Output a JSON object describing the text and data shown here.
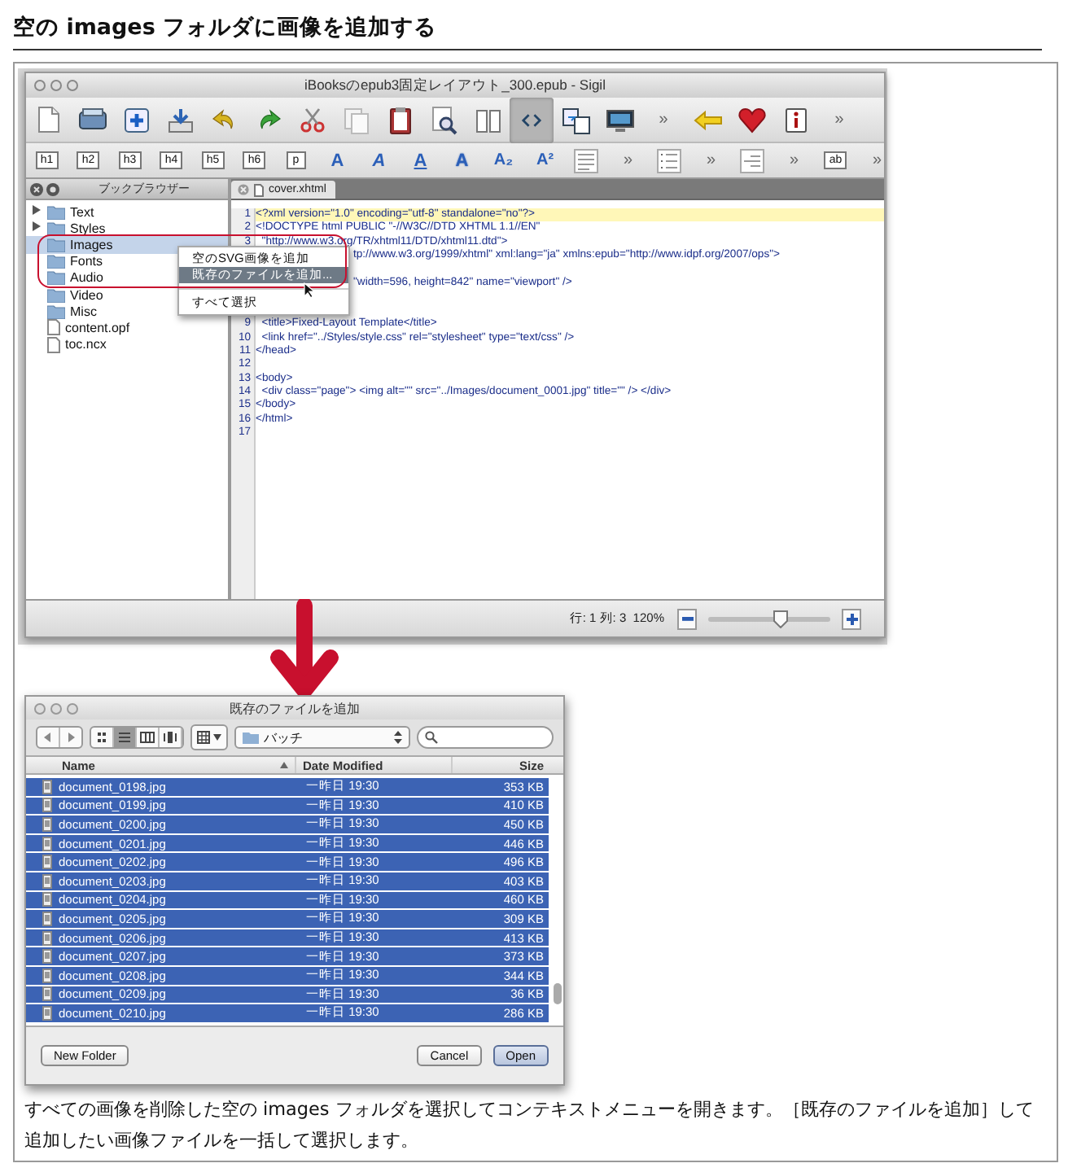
{
  "heading": "空の images フォルダに画像を追加する",
  "sigil": {
    "title": "iBooksのepub3固定レイアウト_300.epub - Sigil",
    "toolbar": [
      {
        "kind": "page"
      },
      {
        "kind": "drawer"
      },
      {
        "kind": "plus"
      },
      {
        "kind": "tray"
      },
      {
        "kind": "undo"
      },
      {
        "kind": "redo"
      },
      {
        "kind": "scissors"
      },
      {
        "kind": "copy"
      },
      {
        "kind": "clipboard"
      },
      {
        "kind": "preview"
      },
      {
        "kind": "book"
      },
      {
        "kind": "code",
        "selected": true
      },
      {
        "kind": "split"
      },
      {
        "kind": "monitor"
      },
      {
        "kind": "text",
        "label": "»"
      },
      {
        "kind": "back"
      },
      {
        "kind": "heart"
      },
      {
        "kind": "info"
      },
      {
        "kind": "text",
        "label": "»"
      }
    ],
    "format_bar": [
      {
        "kind": "tag",
        "label": "h1"
      },
      {
        "kind": "tag",
        "label": "h2"
      },
      {
        "kind": "tag",
        "label": "h3"
      },
      {
        "kind": "tag",
        "label": "h4"
      },
      {
        "kind": "tag",
        "label": "h5"
      },
      {
        "kind": "tag",
        "label": "h6"
      },
      {
        "kind": "tag",
        "label": "p"
      },
      {
        "kind": "bold",
        "label": "A"
      },
      {
        "kind": "italic",
        "label": "A"
      },
      {
        "kind": "underline",
        "label": "A"
      },
      {
        "kind": "outline",
        "label": "A"
      },
      {
        "kind": "subscript",
        "label": "A₂"
      },
      {
        "kind": "superscript",
        "label": "A²"
      },
      {
        "kind": "align"
      },
      {
        "kind": "text",
        "label": "»"
      },
      {
        "kind": "list"
      },
      {
        "kind": "text",
        "label": "»"
      },
      {
        "kind": "indent"
      },
      {
        "kind": "text",
        "label": "»"
      },
      {
        "kind": "tag",
        "label": "ab"
      },
      {
        "kind": "text",
        "label": "»"
      }
    ],
    "browser_title": "ブックブラウザー",
    "tree": [
      {
        "label": "Text",
        "kind": "folder",
        "expandable": true,
        "selected": false
      },
      {
        "label": "Styles",
        "kind": "folder",
        "expandable": true,
        "selected": false
      },
      {
        "label": "Images",
        "kind": "folder",
        "expandable": false,
        "selected": true
      },
      {
        "label": "Fonts",
        "kind": "folder",
        "expandable": false,
        "selected": false
      },
      {
        "label": "Audio",
        "kind": "folder",
        "expandable": false,
        "selected": false
      },
      {
        "label": "Video",
        "kind": "folder",
        "expandable": false,
        "selected": false
      },
      {
        "label": "Misc",
        "kind": "folder",
        "expandable": false,
        "selected": false
      },
      {
        "label": "content.opf",
        "kind": "file",
        "expandable": false,
        "selected": false
      },
      {
        "label": "toc.ncx",
        "kind": "file",
        "expandable": false,
        "selected": false
      }
    ],
    "tab": "cover.xhtml",
    "code": [
      {
        "kind": "code",
        "number": "1",
        "text": "<?xml version=\"1.0\" encoding=\"utf-8\" standalone=\"no\"?>",
        "current": true
      },
      {
        "kind": "code",
        "number": "2",
        "text": "<!DOCTYPE html PUBLIC \"-//W3C//DTD XHTML 1.1//EN\"",
        "current": false
      },
      {
        "kind": "code",
        "number": "3",
        "text": "  \"http://www.w3.org/TR/xhtml11/DTD/xhtml11.dtd\">",
        "current": false
      },
      {
        "kind": "covered",
        "text": "tp://www.w3.org/1999/xhtml\" xml:lang=\"ja\" xmlns:epub=\"http://www.idpf.org/2007/ops\">"
      },
      {
        "kind": "covered"
      },
      {
        "kind": "covered",
        "text": "\"width=596, height=842\" name=\"viewport\" />"
      },
      {
        "kind": "covered"
      },
      {
        "kind": "covered"
      },
      {
        "kind": "code",
        "number": "9",
        "text": "  <title>Fixed-Layout Template</title>",
        "current": false
      },
      {
        "kind": "code",
        "number": "10",
        "text": "  <link href=\"../Styles/style.css\" rel=\"stylesheet\" type=\"text/css\" />",
        "current": false
      },
      {
        "kind": "code",
        "number": "11",
        "text": "</head>",
        "current": false
      },
      {
        "kind": "code",
        "number": "12",
        "current": false
      },
      {
        "kind": "code",
        "number": "13",
        "text": "<body>",
        "current": false
      },
      {
        "kind": "code",
        "number": "14",
        "text": "  <div class=\"page\"> <img alt=\"\" src=\"../Images/document_0001.jpg\" title=\"\" /> </div>",
        "current": false
      },
      {
        "kind": "code",
        "number": "15",
        "text": "</body>",
        "current": false
      },
      {
        "kind": "code",
        "number": "16",
        "text": "</html>",
        "current": false
      },
      {
        "kind": "code",
        "number": "17",
        "current": false
      }
    ],
    "menu": [
      {
        "kind": "item",
        "label": "空のSVG画像を追加",
        "selected": false
      },
      {
        "kind": "item",
        "label": "既存のファイルを追加...",
        "selected": true
      },
      {
        "kind": "separator"
      },
      {
        "kind": "item",
        "label": "すべて選択",
        "selected": false
      }
    ],
    "status": "行: 1 列: 3  120%",
    "zoom": {
      "level": 0.6
    }
  },
  "dialog": {
    "title": "既存のファイルを追加",
    "views": [
      {
        "kind": "icons",
        "selected": false
      },
      {
        "kind": "list",
        "selected": true
      },
      {
        "kind": "columns",
        "selected": false
      },
      {
        "kind": "coverflow",
        "selected": false
      }
    ],
    "location": "バッチ",
    "columns": [
      "Name",
      "Date Modified",
      "Size"
    ],
    "rows": [
      {
        "name": "document_0198.jpg",
        "date": "一昨日 19:30",
        "size": "353 KB",
        "selected": true
      },
      {
        "name": "document_0199.jpg",
        "date": "一昨日 19:30",
        "size": "410 KB",
        "selected": true
      },
      {
        "name": "document_0200.jpg",
        "date": "一昨日 19:30",
        "size": "450 KB",
        "selected": true
      },
      {
        "name": "document_0201.jpg",
        "date": "一昨日 19:30",
        "size": "446 KB",
        "selected": true
      },
      {
        "name": "document_0202.jpg",
        "date": "一昨日 19:30",
        "size": "496 KB",
        "selected": true
      },
      {
        "name": "document_0203.jpg",
        "date": "一昨日 19:30",
        "size": "403 KB",
        "selected": true
      },
      {
        "name": "document_0204.jpg",
        "date": "一昨日 19:30",
        "size": "460 KB",
        "selected": true
      },
      {
        "name": "document_0205.jpg",
        "date": "一昨日 19:30",
        "size": "309 KB",
        "selected": true
      },
      {
        "name": "document_0206.jpg",
        "date": "一昨日 19:30",
        "size": "413 KB",
        "selected": true
      },
      {
        "name": "document_0207.jpg",
        "date": "一昨日 19:30",
        "size": "373 KB",
        "selected": true
      },
      {
        "name": "document_0208.jpg",
        "date": "一昨日 19:30",
        "size": "344 KB",
        "selected": true
      },
      {
        "name": "document_0209.jpg",
        "date": "一昨日 19:30",
        "size": "36 KB",
        "selected": true
      },
      {
        "name": "document_0210.jpg",
        "date": "一昨日 19:30",
        "size": "286 KB",
        "selected": true
      }
    ],
    "buttons": [
      {
        "label": "New Folder",
        "kind": "secondary"
      },
      {
        "label": "Cancel",
        "kind": "secondary"
      },
      {
        "label": "Open",
        "kind": "default"
      }
    ]
  },
  "caption": "すべての画像を削除した空の images フォルダを選択してコンテキストメニューを開きます。［既存のファイルを追加］して追加したい画像ファイルを一括して選択します。"
}
